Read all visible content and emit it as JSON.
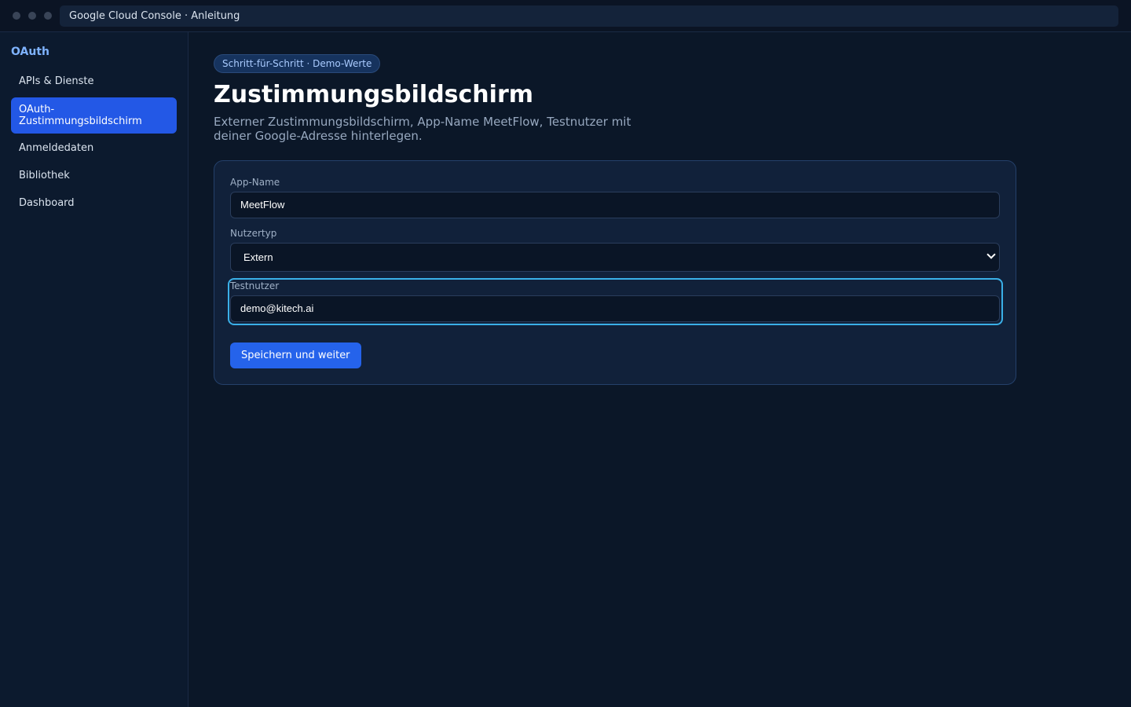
{
  "window": {
    "title": "Google Cloud Console · Anleitung"
  },
  "sidebar": {
    "title": "OAuth",
    "items": [
      {
        "label": "APIs & Dienste"
      },
      {
        "label": "OAuth-Zustimmungsbildschirm",
        "active": true
      },
      {
        "label": "Anmeldedaten"
      },
      {
        "label": "Bibliothek"
      },
      {
        "label": "Dashboard"
      }
    ]
  },
  "main": {
    "badge": "Schritt-für-Schritt · Demo-Werte",
    "title": "Zustimmungsbildschirm",
    "subtitle": "Externer Zustimmungsbildschirm, App-Name MeetFlow, Testnutzer mit deiner Google-Adresse hinterlegen.",
    "form": {
      "app_name": {
        "label": "App-Name",
        "value": "MeetFlow"
      },
      "user_type": {
        "label": "Nutzertyp",
        "value": "Extern"
      },
      "test_users": {
        "label": "Testnutzer",
        "value": "demo@kitech.ai"
      },
      "submit_label": "Speichern und weiter"
    }
  },
  "colors": {
    "background": "#0b1728",
    "accent": "#2563eb",
    "focus": "#3ab0e8",
    "active_nav": "#2358e6"
  }
}
